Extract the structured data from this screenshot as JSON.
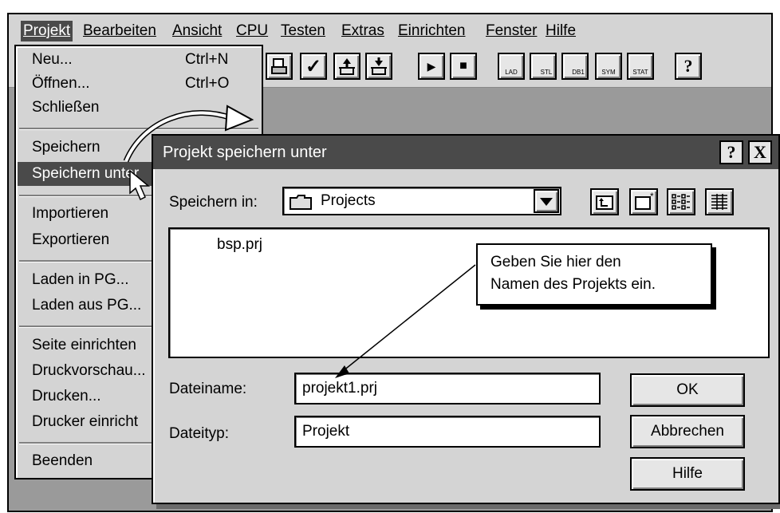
{
  "menubar": {
    "items": [
      {
        "label": "Projekt"
      },
      {
        "label": "Bearbeiten"
      },
      {
        "label": "Ansicht"
      },
      {
        "label": "CPU"
      },
      {
        "label": "Testen"
      },
      {
        "label": "Extras"
      },
      {
        "label": "Einrichten"
      },
      {
        "label": "Fenster"
      },
      {
        "label": "Hilfe"
      }
    ]
  },
  "toolbar": {
    "check": "✓",
    "play": "▶",
    "stop": "■",
    "lad": "LAD",
    "stl": "STL",
    "db1": "DB1",
    "sym": "SYM",
    "stat": "STAT",
    "help": "?"
  },
  "dropdown": {
    "neu": "Neu...",
    "neu_shortcut": "Ctrl+N",
    "oeffnen": "Öffnen...",
    "oeffnen_shortcut": "Ctrl+O",
    "schliessen": "Schließen",
    "speichern": "Speichern",
    "speichern_unter": "Speichern unter",
    "importieren": "Importieren",
    "exportieren": "Exportieren",
    "laden_in": "Laden in PG...",
    "laden_aus": "Laden aus PG...",
    "seite": "Seite einrichten",
    "druckvorschau": "Druckvorschau...",
    "drucken": "Drucken...",
    "drucker": "Drucker einricht",
    "beenden": "Beenden"
  },
  "dialog": {
    "title": "Projekt speichern unter",
    "help_btn": "?",
    "close_btn": "X",
    "save_in_label": "Speichern in:",
    "save_in_value": "Projects",
    "files": [
      "bsp.prj"
    ],
    "filename_label": "Dateiname:",
    "filename_value": "projekt1.prj",
    "filetype_label": "Dateityp:",
    "filetype_value": "Projekt",
    "ok": "OK",
    "cancel": "Abbrechen",
    "help": "Hilfe"
  },
  "callout": {
    "line1": "Geben Sie hier den",
    "line2": "Namen des Projekts ein."
  }
}
